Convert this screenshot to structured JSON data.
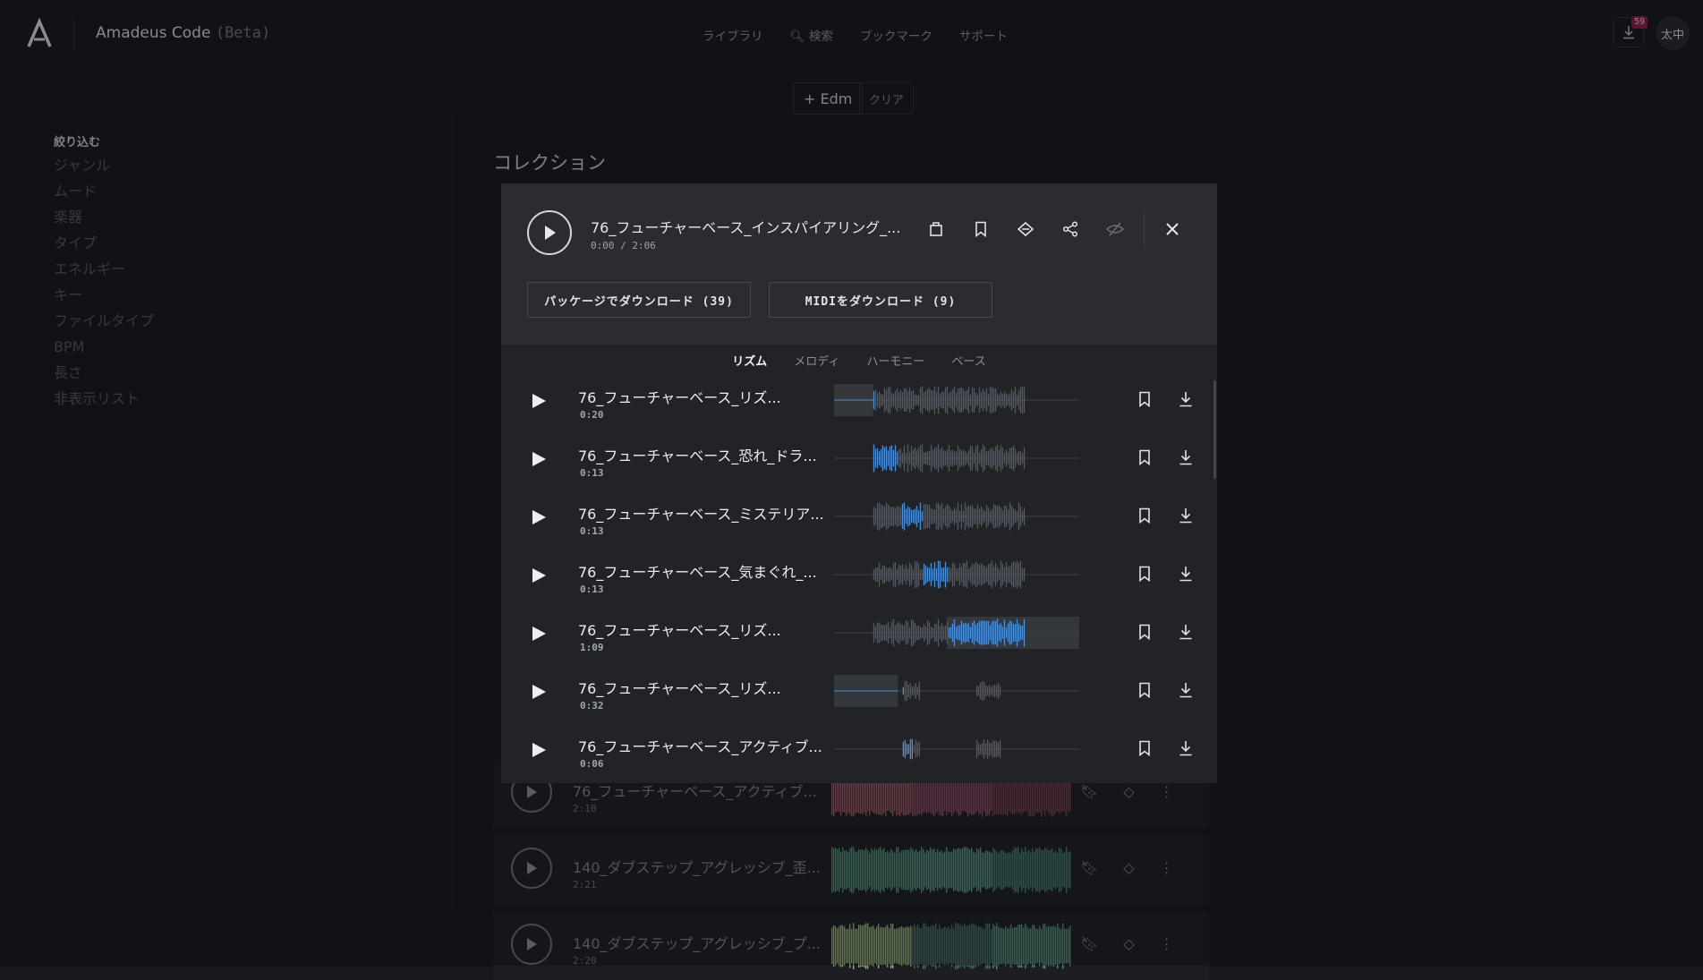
{
  "app": {
    "name": "Amadeus Code",
    "beta": "(Beta)",
    "download_count": "59",
    "user_initials": "太中"
  },
  "nav": {
    "library": "ライブラリ",
    "search": "検索",
    "bookmarks": "ブックマーク",
    "support": "サポート"
  },
  "filter_chips": {
    "active": "+ Edm",
    "clear": "クリア"
  },
  "sidebar": {
    "title": "絞り込む",
    "items": [
      "ジャンル",
      "ムード",
      "楽器",
      "タイプ",
      "エネルギー",
      "キー",
      "ファイルタイプ",
      "BPM",
      "長さ",
      "非表示リスト"
    ]
  },
  "section_title": "コレクション",
  "background_tracks": [
    {
      "title": "76_フューチャーベース_アクティブ...",
      "time": "2:10",
      "colors": [
        "#c24a58",
        "#b03a66",
        "#8e2f4a"
      ]
    },
    {
      "title": "140_ダブステップ_アグレッシブ_歪...",
      "time": "2:21",
      "colors": [
        "#2f9e78",
        "#37a889",
        "#2a8a6e"
      ]
    },
    {
      "title": "140_ダブステップ_アグレッシブ_プ...",
      "time": "2:20",
      "colors": [
        "#8fbf5a",
        "#2e7a6e",
        "#3aa07a"
      ]
    }
  ],
  "modal": {
    "title": "76_フューチャーベース_インスパイアリング_...",
    "time": "0:00 / 2:06",
    "download_package": "パッケージでダウンロード (39)",
    "download_midi": "MIDIをダウンロード (9)",
    "tabs": [
      "リズム",
      "メロディ",
      "ハーモニー",
      "ベース"
    ],
    "active_tab": "リズム",
    "accent_color": "#4f8fd6",
    "stems": [
      {
        "title": "76_フューチャーベース_リズ...",
        "time": "0:20"
      },
      {
        "title": "76_フューチャーベース_恐れ_ドラ...",
        "time": "0:13"
      },
      {
        "title": "76_フューチャーベース_ミステリア...",
        "time": "0:13"
      },
      {
        "title": "76_フューチャーベース_気まぐれ_...",
        "time": "0:13"
      },
      {
        "title": "76_フューチャーベース_リズ...",
        "time": "1:09"
      },
      {
        "title": "76_フューチャーベース_リズ...",
        "time": "0:32"
      },
      {
        "title": "76_フューチャーベース_アクティブ...",
        "time": "0:06"
      }
    ]
  }
}
